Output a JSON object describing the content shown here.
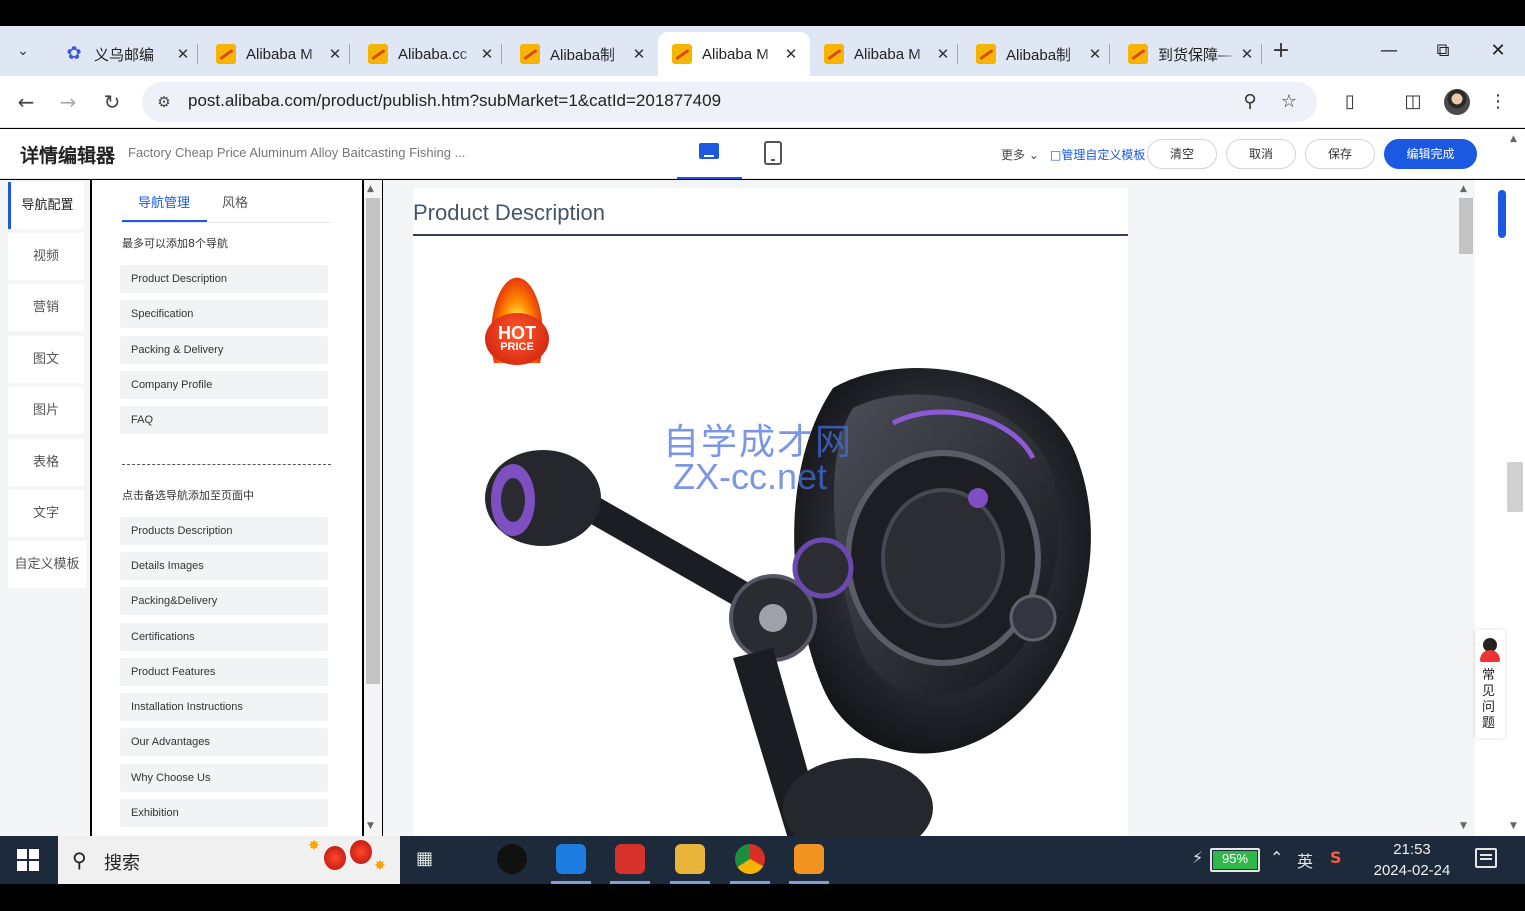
{
  "browser": {
    "tabs": [
      {
        "title": "义乌邮编",
        "active": false,
        "icon": "baidu-paw-icon"
      },
      {
        "title": "Alibaba M",
        "active": false,
        "icon": "alibaba-icon"
      },
      {
        "title": "Alibaba.cc",
        "active": false,
        "icon": "alibaba-icon"
      },
      {
        "title": "Alibaba制",
        "active": false,
        "icon": "alibaba-icon"
      },
      {
        "title": "Alibaba M",
        "active": true,
        "icon": "alibaba-icon"
      },
      {
        "title": "Alibaba M",
        "active": false,
        "icon": "alibaba-icon"
      },
      {
        "title": "Alibaba制",
        "active": false,
        "icon": "alibaba-icon"
      },
      {
        "title": "到货保障—",
        "active": false,
        "icon": "alibaba-icon"
      }
    ],
    "url": "post.alibaba.com/product/publish.htm?subMarket=1&catId=201877409"
  },
  "editor": {
    "title": "详情编辑器",
    "product_name": "Factory Cheap Price Aluminum Alloy Baitcasting Fishing ...",
    "more_label": "更多",
    "manage_templates_label": "□管理自定义模板",
    "buttons": {
      "clear": "清空",
      "cancel": "取消",
      "save": "保存",
      "finish": "编辑完成"
    }
  },
  "side_nav": {
    "items": [
      {
        "label": "导航配置",
        "active": true
      },
      {
        "label": "视频",
        "active": false
      },
      {
        "label": "营销",
        "active": false
      },
      {
        "label": "图文",
        "active": false
      },
      {
        "label": "图片",
        "active": false
      },
      {
        "label": "表格",
        "active": false
      },
      {
        "label": "文字",
        "active": false
      },
      {
        "label": "自定义模板",
        "active": false
      }
    ]
  },
  "panel": {
    "tabs": [
      {
        "label": "导航管理",
        "active": true
      },
      {
        "label": "风格",
        "active": false
      }
    ],
    "added_hint": "最多可以添加8个导航",
    "added_items": [
      "Product Description",
      "Specification",
      "Packing & Delivery",
      "Company Profile",
      "FAQ"
    ],
    "candidate_hint": "点击备选导航添加至页面中",
    "candidate_items": [
      "Products Description",
      "Details Images",
      "Packing&Delivery",
      "Certifications",
      "Product Features",
      "Installation Instructions",
      "Our Advantages",
      "Why Choose Us",
      "Exhibition"
    ]
  },
  "canvas": {
    "section_heading": "Product Description",
    "badge_line1": "HOT",
    "badge_line2": "PRICE",
    "watermark_cn": "自学成才网",
    "watermark_en": "ZX-cc.net"
  },
  "faq_float": {
    "label": "常见问题"
  },
  "taskbar": {
    "search_label": "搜索",
    "battery_percent": "95%",
    "ime_label": "英",
    "time": "21:53",
    "date": "2024-02-24"
  },
  "colors": {
    "accent": "#1b59e3",
    "taskbar": "#1c2a3b",
    "tabstrip": "#dfe7f4"
  }
}
